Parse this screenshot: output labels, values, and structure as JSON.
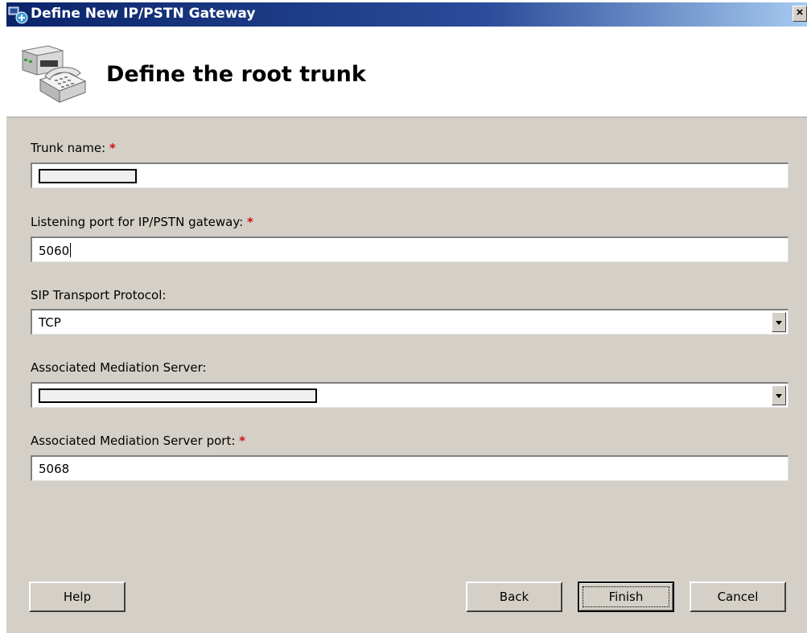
{
  "window": {
    "title": "Define New IP/PSTN Gateway",
    "close_label": "×"
  },
  "header": {
    "title": "Define the root trunk"
  },
  "form": {
    "required_marker": "*",
    "trunk_name": {
      "label": "Trunk name:",
      "value": ""
    },
    "listening_port": {
      "label": "Listening port for IP/PSTN gateway:",
      "value": "5060"
    },
    "sip_transport": {
      "label": "SIP Transport Protocol:",
      "value": "TCP"
    },
    "mediation_server": {
      "label": "Associated Mediation Server:",
      "value": ""
    },
    "mediation_port": {
      "label": "Associated Mediation Server port:",
      "value": "5068"
    }
  },
  "buttons": {
    "help": "Help",
    "back": "Back",
    "finish": "Finish",
    "cancel": "Cancel"
  },
  "colors": {
    "title_bar": "#0a246a",
    "dialog_bg": "#d4d0c8",
    "required": "#d01010"
  }
}
